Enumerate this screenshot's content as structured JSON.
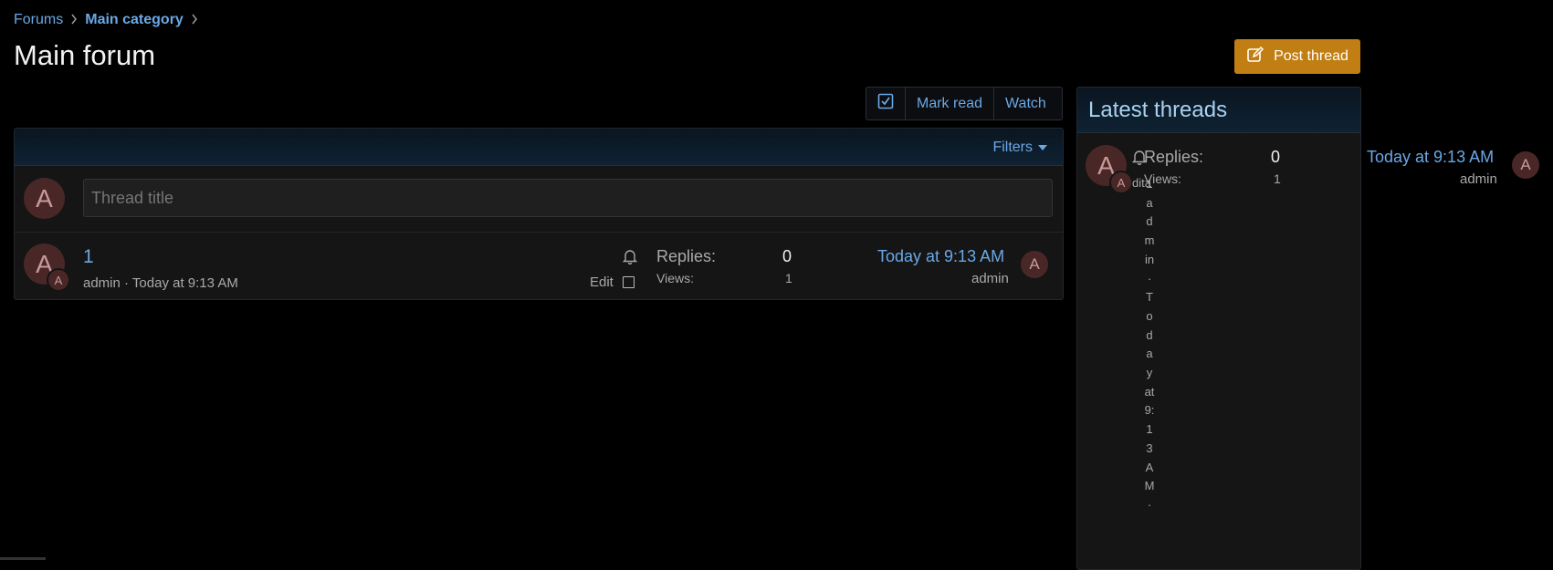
{
  "breadcrumb": {
    "items": [
      "Forums",
      "Main category"
    ]
  },
  "page": {
    "title": "Main forum"
  },
  "toolbar": {
    "post_thread": "Post thread",
    "mark_read": "Mark read",
    "watch": "Watch"
  },
  "filters": {
    "label": "Filters"
  },
  "new_thread": {
    "avatar_letter": "A",
    "placeholder": "Thread title"
  },
  "thread": {
    "avatar_letter": "A",
    "mini_avatar_letter": "A",
    "title": "1",
    "author": "admin",
    "meta_sep": " · ",
    "date": "Today at 9:13 AM",
    "edit_label": "Edit",
    "replies_label": "Replies:",
    "replies": "0",
    "views_label": "Views:",
    "views": "1",
    "last_date": "Today at 9:13 AM",
    "last_user": "admin",
    "last_avatar_letter": "A"
  },
  "sidebar": {
    "title": "Latest threads",
    "item": {
      "avatar_letter": "A",
      "mini_avatar_letter": "A",
      "overlay_fragment": "dita",
      "vertical_text": "1admin·Todayat9:13AM·",
      "replies_label": "Replies:",
      "replies": "0",
      "views_label": "Views:",
      "views": "1",
      "last_date": "Today at 9:13 AM",
      "last_user": "admin",
      "last_avatar_letter": "A"
    }
  },
  "colors": {
    "accent": "#6aa8e6",
    "button": "#c17e12",
    "avatar": "#4a2727"
  },
  "icons": [
    "chevron-right-icon",
    "edit-icon",
    "check-square-icon",
    "caret-down-icon",
    "bell-icon",
    "checkbox-icon"
  ]
}
